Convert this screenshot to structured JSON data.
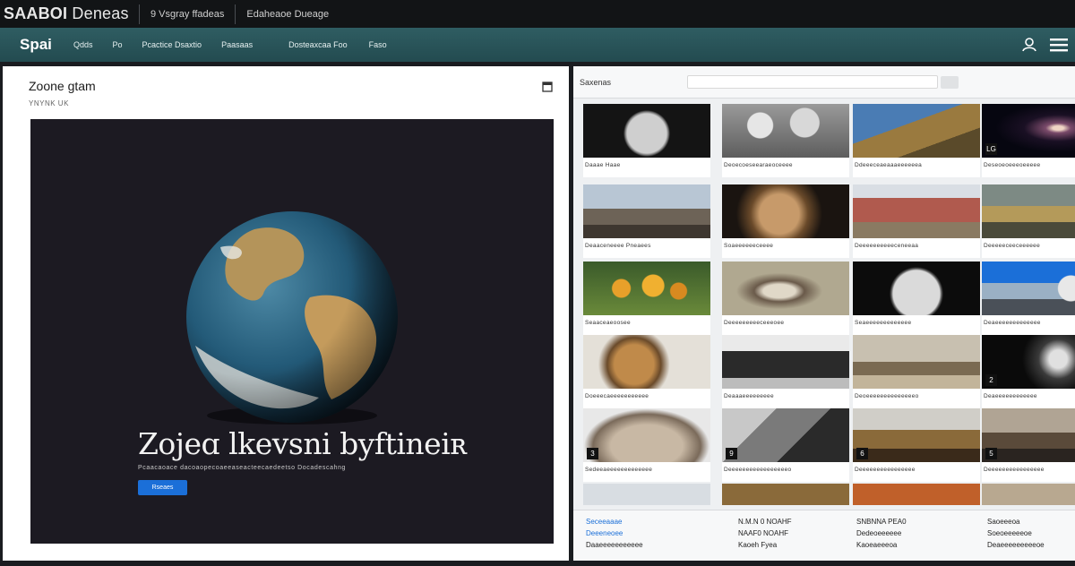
{
  "topbar": {
    "brand_bold": "SAABOI",
    "brand_rest": " Deneas",
    "item1": "9 Vsgray ffadeas",
    "item2": "Edaheaoe Dueage"
  },
  "nav": {
    "logo": "Spai",
    "items": [
      "Qdds",
      "Po",
      "Pcactice Dsaxtio",
      "Paasaas",
      "Dosteaxcaa Foo",
      "Faso"
    ],
    "user_icon": "user-icon",
    "menu_icon": "menu-icon"
  },
  "left": {
    "title": "Zoone gtam",
    "subtitle": "YNYNK UK",
    "hero": {
      "title": "Zojeɑ lkevsni byftineiʀ",
      "description": "Pcaacaoace dacoaopecoaeeaseacteecaedeetso Docadescahng",
      "button": "Rseaes"
    }
  },
  "right": {
    "label": "Saxenas",
    "tiles": [
      {
        "caption": "Daaae Haae",
        "theme": "moon"
      },
      {
        "caption": "Deoecoeseearaeoceeee",
        "theme": "bones"
      },
      {
        "caption": "Ddeeeceaeaaaeeeeeea",
        "theme": "giraffe"
      },
      {
        "caption": "Deseoeoeeeoeeeee",
        "theme": "galaxy",
        "num": "LG"
      },
      {
        "caption": "Deaaceneeee Pneaees",
        "theme": "stones"
      },
      {
        "caption": "Soaeeeeeeceeee",
        "theme": "shell"
      },
      {
        "caption": "Deeeeeeeeeeceneeaa",
        "theme": "creature"
      },
      {
        "caption": "Deeeeeceeceeeeee",
        "theme": "turtle"
      },
      {
        "caption": "Seaaceaeoosee",
        "theme": "flowers"
      },
      {
        "caption": "Deeeeeeeeeceeeoee",
        "theme": "seal"
      },
      {
        "caption": "Seaeeeeeeeeeeeee",
        "theme": "moon2"
      },
      {
        "caption": "Deaeeeeeeeeeeeee",
        "theme": "sky"
      },
      {
        "caption": "Doeeecaeeeeeeeeeee",
        "theme": "leopard"
      },
      {
        "caption": "Deaaaeeeeeeeee",
        "theme": "mountain"
      },
      {
        "caption": "Deoeeeeeeeeeeeeeeo",
        "theme": "camel"
      },
      {
        "caption": "Deaeeeeeeeeeeee",
        "theme": "dark",
        "num": "2"
      },
      {
        "caption": "Sedeeaeeeeeeeeeeeee",
        "theme": "jupiter",
        "num": "3"
      },
      {
        "caption": "Deeeeeeeeeeeeeeeeeo",
        "theme": "grey",
        "num": "9"
      },
      {
        "caption": "Deeeeeeeeeeeeeeee",
        "theme": "snake",
        "num": "6"
      },
      {
        "caption": "Deeeeeeeeeeeeeeee",
        "theme": "horse",
        "num": "5"
      }
    ],
    "footer": [
      {
        "line1": "Seceeaaae",
        "line2": "Deeeneoee",
        "line3": "Daaeeeeeeeeeee"
      },
      {
        "line1": "N.M.N 0 NOAHF",
        "line2": "NAAF0 NOAHF",
        "line3": "Kaoeh Fyea"
      },
      {
        "line1": "SNBNNA PEA0",
        "line2": "Dedeoeeeeee",
        "line3": "Kaoeaeeeoa"
      },
      {
        "line1": "Saoeeeoa",
        "line2": "Soeoeeeeeoe",
        "line3": "Deaeeeeeeeeeoe"
      }
    ]
  }
}
